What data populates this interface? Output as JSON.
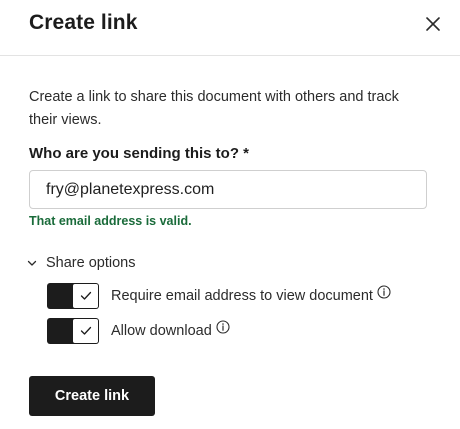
{
  "dialog": {
    "title": "Create link",
    "close_icon": "close-icon"
  },
  "description": "Create a link to share this document with others and track their views.",
  "recipient": {
    "label": "Who are you sending this to? *",
    "value": "fry@planetexpress.com",
    "validation_message": "That email address is valid.",
    "validation_color": "#1a6b3a"
  },
  "share_options": {
    "label": "Share options",
    "expanded": true,
    "options": [
      {
        "label": "Require email address to view document",
        "enabled": true,
        "info_icon": "info-icon"
      },
      {
        "label": "Allow download",
        "enabled": true,
        "info_icon": "info-icon"
      }
    ]
  },
  "actions": {
    "create_label": "Create link",
    "accent_color": "#1c1c1c"
  }
}
